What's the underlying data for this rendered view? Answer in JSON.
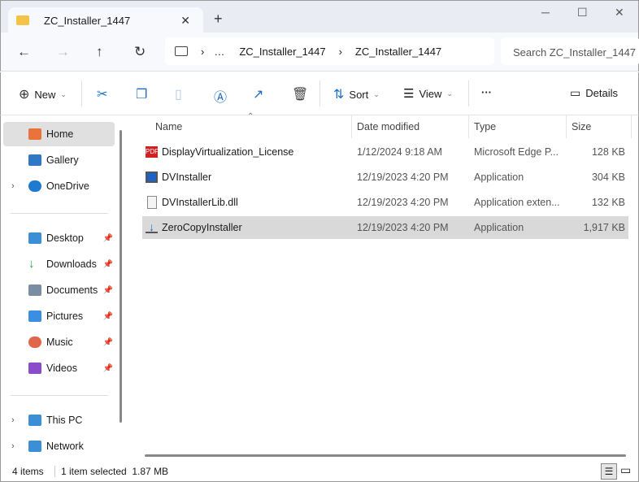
{
  "window": {
    "tab_title": "ZC_Installer_1447",
    "new_tab": "+",
    "close_tab": "✕",
    "minimize": "─",
    "maximize": "☐",
    "close": "✕"
  },
  "nav": {
    "back": "←",
    "forward": "→",
    "up": "↑",
    "refresh": "↻",
    "breadcrumb": [
      "…",
      "ZC_Installer_1447",
      "ZC_Installer_1447"
    ],
    "search_placeholder": "Search ZC_Installer_1447"
  },
  "toolbar": {
    "new": "New",
    "sort": "Sort",
    "view": "View",
    "more": "···",
    "details": "Details"
  },
  "sidebar": {
    "items": [
      {
        "label": "Home",
        "color": "#e8743b"
      },
      {
        "label": "Gallery",
        "color": "#2f78c5"
      },
      {
        "label": "OneDrive",
        "color": "#1f7bd1"
      },
      {
        "label": "Desktop",
        "color": "#3a8fd6"
      },
      {
        "label": "Downloads",
        "color": "#2a9d54"
      },
      {
        "label": "Documents",
        "color": "#7a8da3"
      },
      {
        "label": "Pictures",
        "color": "#3b8fe0"
      },
      {
        "label": "Music",
        "color": "#e0674a"
      },
      {
        "label": "Videos",
        "color": "#8b4cc9"
      },
      {
        "label": "This PC",
        "color": "#3a8fd6"
      },
      {
        "label": "Network",
        "color": "#3a8fd6"
      }
    ]
  },
  "columns": [
    "Name",
    "Date modified",
    "Type",
    "Size"
  ],
  "files": [
    {
      "name": "DisplayVirtualization_License",
      "date": "1/12/2024 9:18 AM",
      "type": "Microsoft Edge P...",
      "size": "128 KB",
      "icon": "pdf-icon"
    },
    {
      "name": "DVInstaller",
      "date": "12/19/2023 4:20 PM",
      "type": "Application",
      "size": "304 KB",
      "icon": "app-icon"
    },
    {
      "name": "DVInstallerLib.dll",
      "date": "12/19/2023 4:20 PM",
      "type": "Application exten...",
      "size": "132 KB",
      "icon": "dll-icon"
    },
    {
      "name": "ZeroCopyInstaller",
      "date": "12/19/2023 4:20 PM",
      "type": "Application",
      "size": "1,917 KB",
      "icon": "installer-icon"
    }
  ],
  "status": {
    "count": "4 items",
    "selected": "1 item selected  1.87 MB"
  }
}
